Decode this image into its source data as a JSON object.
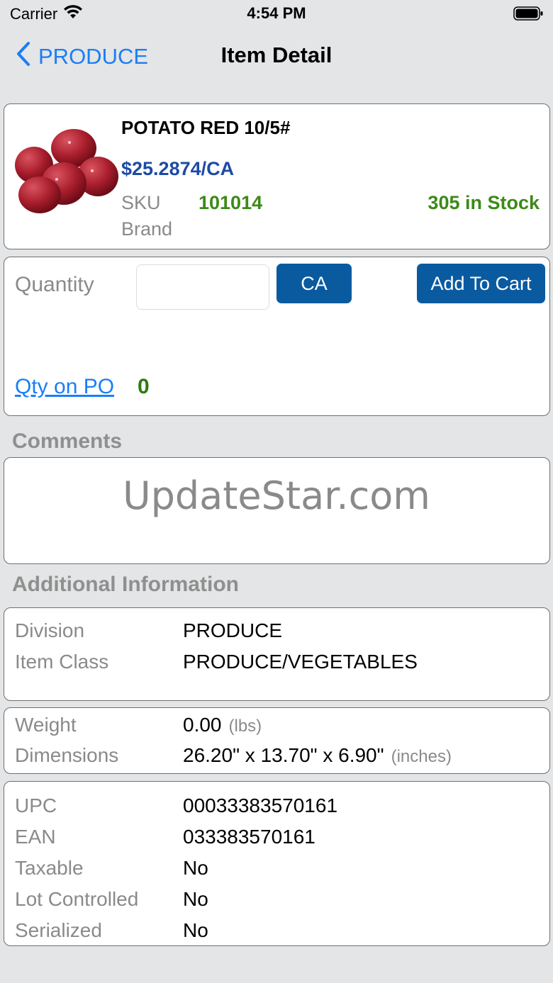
{
  "status": {
    "carrier": "Carrier",
    "time": "4:54 PM"
  },
  "nav": {
    "back_label": "PRODUCE",
    "title": "Item Detail"
  },
  "item": {
    "name": "POTATO RED 10/5#",
    "price": "$25.2874/CA",
    "sku_label": "SKU",
    "sku": "101014",
    "stock": "305 in Stock",
    "brand_label": "Brand",
    "image": "red-potatoes-image"
  },
  "order": {
    "quantity_label": "Quantity",
    "quantity_value": "",
    "unit_button": "CA",
    "add_to_cart": "Add To Cart",
    "qty_on_po_label": "Qty on PO",
    "qty_on_po_value": "0"
  },
  "comments": {
    "title": "Comments",
    "watermark": "UpdateStar.com"
  },
  "additional": {
    "title": "Additional Information",
    "division_label": "Division",
    "division": "PRODUCE",
    "item_class_label": "Item Class",
    "item_class": "PRODUCE/VEGETABLES",
    "weight_label": "Weight",
    "weight": "0.00",
    "weight_unit": "(lbs)",
    "dimensions_label": "Dimensions",
    "dimensions": "26.20\" x 13.70\" x 6.90\"",
    "dimensions_unit": "(inches)",
    "upc_label": "UPC",
    "upc": "00033383570161",
    "ean_label": "EAN",
    "ean": "033383570161",
    "taxable_label": "Taxable",
    "taxable": "No",
    "lot_label": "Lot Controlled",
    "lot": "No",
    "serialized_label": "Serialized",
    "serialized": "No"
  },
  "colors": {
    "accent": "#1a7ef7",
    "button": "#0a5aa0",
    "price": "#1d4ba4",
    "stock": "#3c8a17"
  }
}
